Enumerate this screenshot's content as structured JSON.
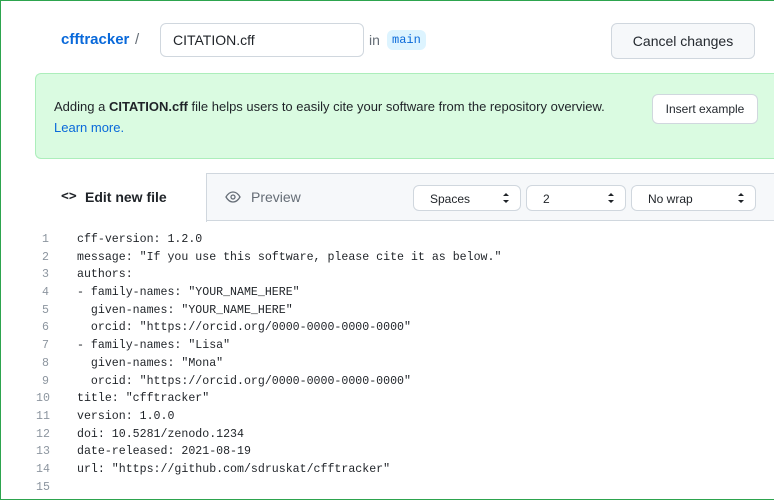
{
  "header": {
    "repo_name": "cfftracker",
    "path_separator": "/",
    "filename_value": "CITATION.cff",
    "in_text": "in",
    "branch": "main",
    "cancel_label": "Cancel changes"
  },
  "banner": {
    "text_before": "Adding a ",
    "filename": "CITATION.cff",
    "text_after": " file helps users to easily cite your software from the repository overview. ",
    "learn_more": "Learn more.",
    "insert_label": "Insert example"
  },
  "editor": {
    "tabs": {
      "edit_icon": "<>",
      "edit_label": "Edit new file",
      "preview_icon": "eye-icon",
      "preview_label": "Preview"
    },
    "indent_mode": "Spaces",
    "indent_size": "2",
    "wrap_mode": "No wrap",
    "colors": {
      "accent": "#0969da",
      "banner_bg": "#dafbe1",
      "frame_border": "#2da44e"
    },
    "lines": [
      {
        "n": "1",
        "text": "cff-version: 1.2.0"
      },
      {
        "n": "2",
        "text": "message: \"If you use this software, please cite it as below.\""
      },
      {
        "n": "3",
        "text": "authors:"
      },
      {
        "n": "4",
        "text": "- family-names: \"YOUR_NAME_HERE\""
      },
      {
        "n": "5",
        "text": "  given-names: \"YOUR_NAME_HERE\""
      },
      {
        "n": "6",
        "text": "  orcid: \"https://orcid.org/0000-0000-0000-0000\""
      },
      {
        "n": "7",
        "text": "- family-names: \"Lisa\""
      },
      {
        "n": "8",
        "text": "  given-names: \"Mona\""
      },
      {
        "n": "9",
        "text": "  orcid: \"https://orcid.org/0000-0000-0000-0000\""
      },
      {
        "n": "10",
        "text": "title: \"cfftracker\""
      },
      {
        "n": "11",
        "text": "version: 1.0.0"
      },
      {
        "n": "12",
        "text": "doi: 10.5281/zenodo.1234"
      },
      {
        "n": "13",
        "text": "date-released: 2021-08-19"
      },
      {
        "n": "14",
        "text": "url: \"https://github.com/sdruskat/cfftracker\""
      },
      {
        "n": "15",
        "text": ""
      }
    ]
  }
}
